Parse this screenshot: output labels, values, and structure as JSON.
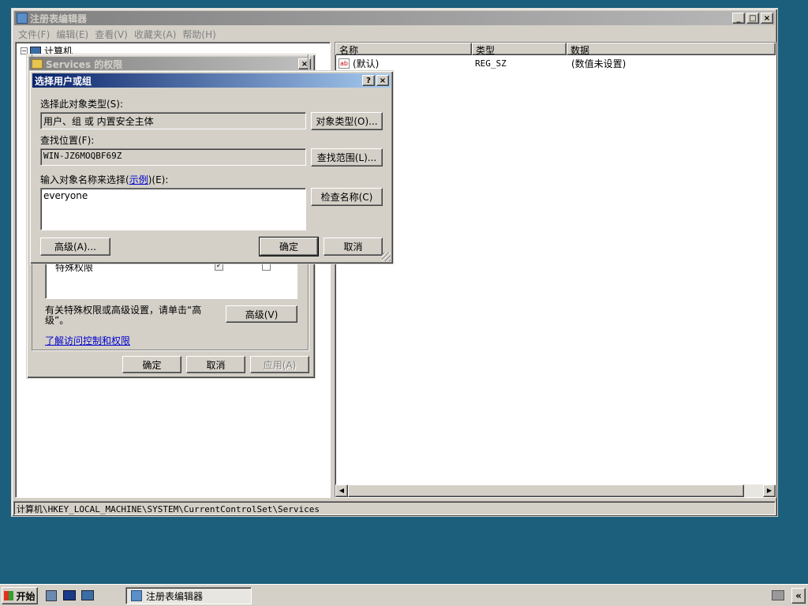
{
  "regedit": {
    "title": "注册表编辑器",
    "menu": [
      "文件(F)",
      "编辑(E)",
      "查看(V)",
      "收藏夹(A)",
      "帮助(H)"
    ],
    "tree_root": "计算机",
    "columns": [
      "名称",
      "类型",
      "数据"
    ],
    "values": [
      {
        "name": "(默认)",
        "type": "REG_SZ",
        "data": "(数值未设置)"
      }
    ],
    "status_path": "计算机\\HKEY_LOCAL_MACHINE\\SYSTEM\\CurrentControlSet\\Services"
  },
  "perm_dialog": {
    "title": "Services 的权限",
    "special_permission": "特殊权限",
    "advanced_hint": "有关特殊权限或高级设置，请单击“高级”。",
    "advanced_button": "高级(V)",
    "learn_link": "了解访问控制和权限",
    "ok": "确定",
    "cancel": "取消",
    "apply": "应用(A)"
  },
  "select_dialog": {
    "title": "选择用户或组",
    "object_type_label": "选择此对象类型(S):",
    "object_type_value": "用户、组 或 内置安全主体",
    "object_type_button": "对象类型(O)...",
    "location_label": "查找位置(F):",
    "location_value": "WIN-JZ6MOQBF69Z",
    "location_button": "查找范围(L)...",
    "names_label_prefix": "输入对象名称来选择(",
    "names_label_link": "示例",
    "names_label_suffix": ")(E):",
    "names_value": "everyone",
    "check_button": "检查名称(C)",
    "advanced_button": "高级(A)...",
    "ok": "确定",
    "cancel": "取消"
  },
  "taskbar": {
    "start": "开始",
    "task_item": "注册表编辑器",
    "tray_arrow": "«"
  }
}
